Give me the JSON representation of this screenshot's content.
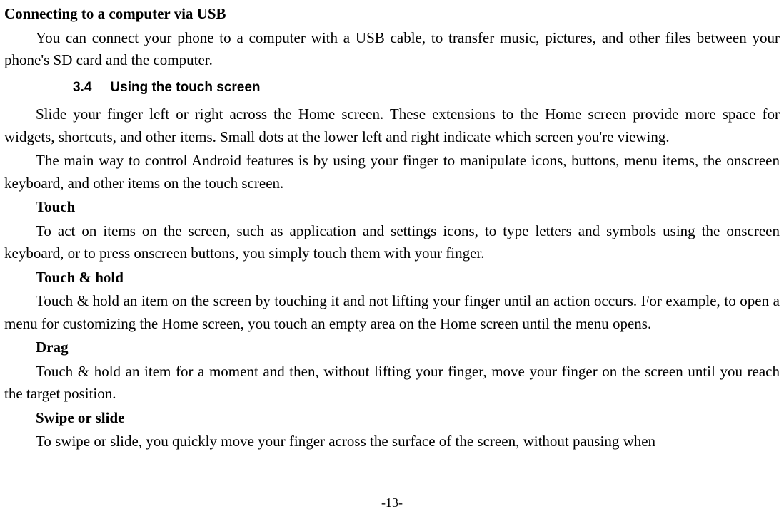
{
  "heading_usb": "Connecting to a computer via USB",
  "para_usb": "You can connect your phone to a computer with a USB cable, to transfer music, pictures, and other files between your phone's SD card and the computer.",
  "section_number": "3.4",
  "section_title": "Using the touch screen",
  "para_touch_intro1": "Slide your finger left or right across the Home screen. These extensions to the Home screen provide more space for widgets, shortcuts, and other items. Small dots at the lower left and right indicate which screen you're viewing.",
  "para_touch_intro2": "The main way to control Android features is by using your finger to manipulate icons, buttons, menu items, the onscreen keyboard, and other items on the touch screen.",
  "sub_touch": "Touch",
  "para_touch": "To act on items on the screen, such as application and settings icons, to type letters and symbols using the onscreen keyboard, or to press onscreen buttons, you simply touch them with your finger.",
  "sub_touch_hold": "Touch & hold",
  "para_touch_hold": "Touch & hold an item on the screen by touching it and not lifting your finger until an action occurs. For example, to open a menu for customizing the Home screen, you touch an empty area on the Home screen until the menu opens.",
  "sub_drag": "Drag",
  "para_drag": "Touch & hold an item for a moment and then, without lifting your finger, move your finger on the screen until you reach the target position.",
  "sub_swipe": "Swipe or slide",
  "para_swipe": "To swipe or slide, you quickly move your finger across the surface of the screen, without pausing when",
  "page_number": "-13-"
}
